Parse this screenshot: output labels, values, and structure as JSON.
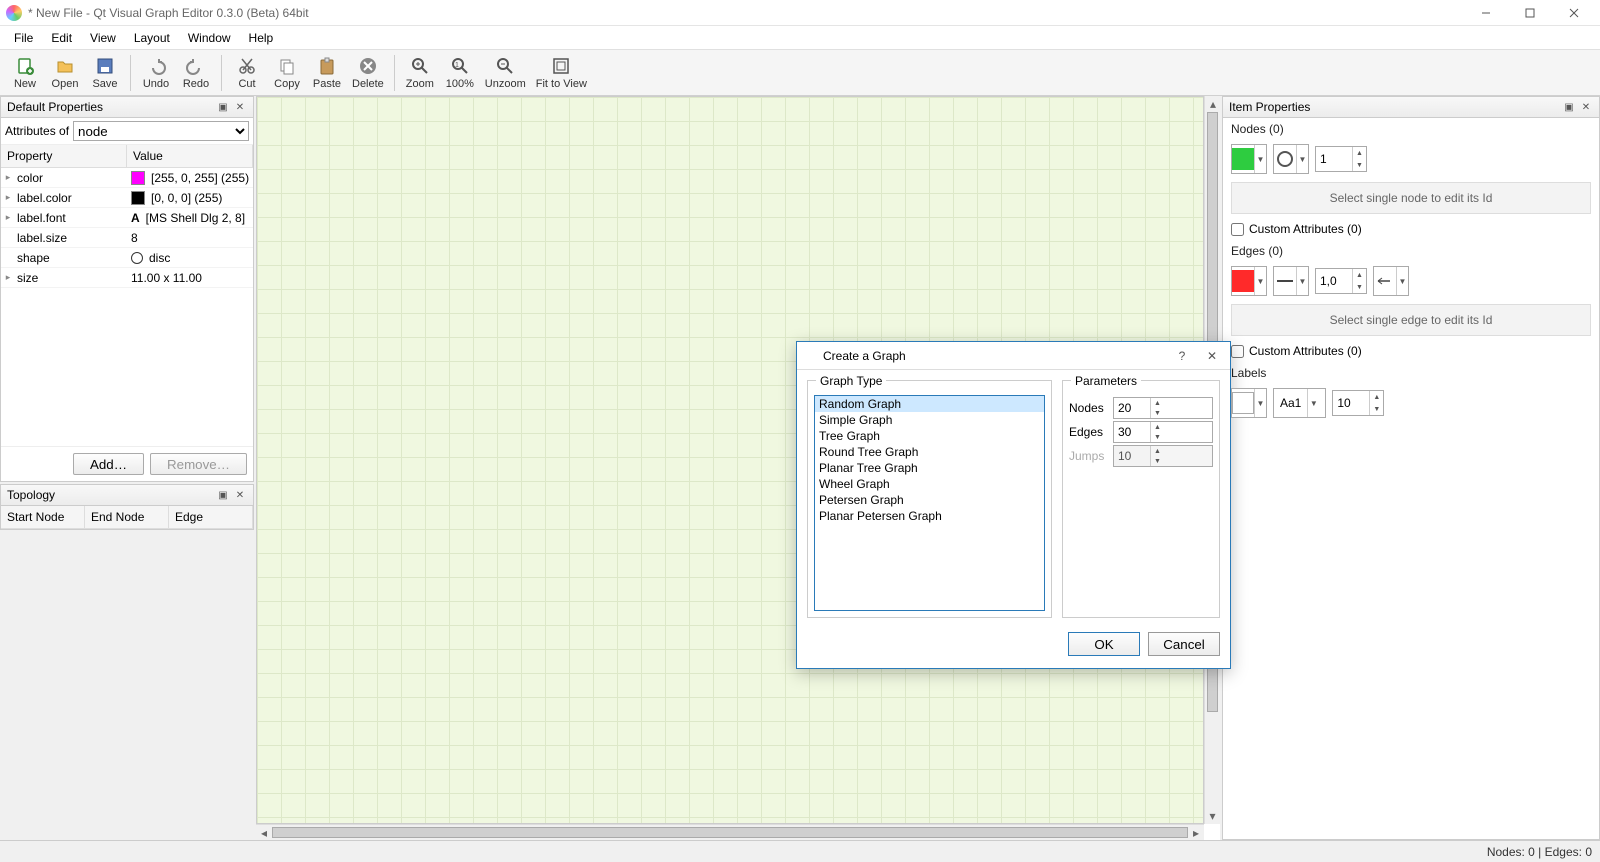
{
  "window": {
    "title": "* New File - Qt Visual Graph Editor 0.3.0 (Beta) 64bit"
  },
  "menu": [
    "File",
    "Edit",
    "View",
    "Layout",
    "Window",
    "Help"
  ],
  "toolbar": [
    {
      "label": "New",
      "icon": "new"
    },
    {
      "label": "Open",
      "icon": "open"
    },
    {
      "label": "Save",
      "icon": "save"
    },
    {
      "sep": true
    },
    {
      "label": "Undo",
      "icon": "undo"
    },
    {
      "label": "Redo",
      "icon": "redo"
    },
    {
      "sep": true
    },
    {
      "label": "Cut",
      "icon": "cut"
    },
    {
      "label": "Copy",
      "icon": "copy"
    },
    {
      "label": "Paste",
      "icon": "paste"
    },
    {
      "label": "Delete",
      "icon": "delete"
    },
    {
      "sep": true
    },
    {
      "label": "Zoom",
      "icon": "zoom"
    },
    {
      "label": "100%",
      "icon": "zoom100"
    },
    {
      "label": "Unzoom",
      "icon": "unzoom"
    },
    {
      "label": "Fit to View",
      "icon": "fit"
    }
  ],
  "left": {
    "defaultProps": {
      "title": "Default Properties",
      "attrOfLabel": "Attributes of",
      "attrOfValue": "node",
      "head": {
        "property": "Property",
        "value": "Value"
      },
      "rows": [
        {
          "name": "color",
          "value": "[255, 0, 255] (255)",
          "swatch": "#ff00ff",
          "expand": true
        },
        {
          "name": "label.color",
          "value": "[0, 0, 0] (255)",
          "swatch": "#000000",
          "expand": true
        },
        {
          "name": "label.font",
          "value": "[MS Shell Dlg 2, 8]",
          "glyph": "A",
          "expand": true
        },
        {
          "name": "label.size",
          "value": "8"
        },
        {
          "name": "shape",
          "value": "disc",
          "shape": true
        },
        {
          "name": "size",
          "value": "11.00 x 11.00",
          "expand": true
        }
      ],
      "addBtn": "Add…",
      "removeBtn": "Remove…"
    },
    "topology": {
      "title": "Topology",
      "columns": [
        "Start Node",
        "End Node",
        "Edge"
      ]
    }
  },
  "right": {
    "title": "Item Properties",
    "nodes": {
      "label": "Nodes (0)",
      "fill": "#2ecc40",
      "stroke": "1",
      "hint": "Select single node to edit its Id",
      "customAttrs": "Custom Attributes (0)"
    },
    "edges": {
      "label": "Edges (0)",
      "fill": "#ff2a2a",
      "val": "1,0",
      "hint": "Select single edge to edit its Id",
      "customAttrs": "Custom Attributes (0)"
    },
    "labels": {
      "label": "Labels",
      "fontBtn": "Aa1",
      "size": "10"
    }
  },
  "dialog": {
    "title": "Create a Graph",
    "graphType": {
      "label": "Graph Type",
      "items": [
        "Random Graph",
        "Simple Graph",
        "Tree Graph",
        "Round Tree Graph",
        "Planar Tree Graph",
        "Wheel Graph",
        "Petersen Graph",
        "Planar Petersen Graph"
      ],
      "selected": "Random Graph"
    },
    "params": {
      "label": "Parameters",
      "nodesLabel": "Nodes",
      "nodes": "20",
      "edgesLabel": "Edges",
      "edges": "30",
      "jumpsLabel": "Jumps",
      "jumps": "10"
    },
    "ok": "OK",
    "cancel": "Cancel"
  },
  "status": "Nodes: 0 | Edges: 0"
}
